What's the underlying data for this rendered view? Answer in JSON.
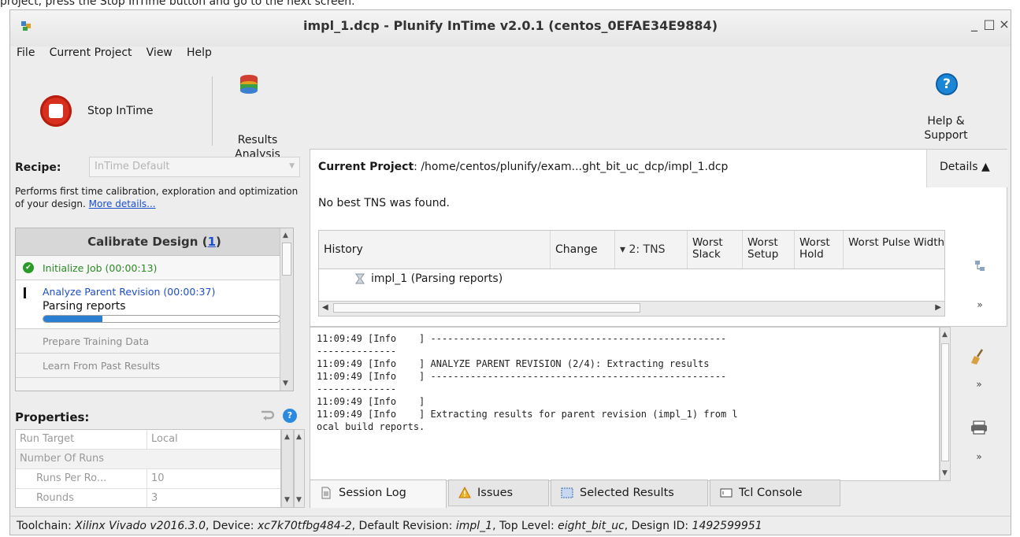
{
  "top_strip_text": "project, press the Stop InTime button and go to the next screen.",
  "window": {
    "title": "impl_1.dcp - Plunify InTime v2.0.1 (centos_0EFAE34E9884)",
    "controls": [
      "_",
      "□",
      "×"
    ]
  },
  "menu": [
    "File",
    "Current Project",
    "View",
    "Help"
  ],
  "toolbar": {
    "stop_label": "Stop InTime",
    "results_label": "Results Analysis",
    "help_label": "Help & Support",
    "help_glyph": "?"
  },
  "recipe": {
    "label": "Recipe:",
    "value": "InTime Default",
    "description": "Performs first time calibration, exploration and optimization of your design.",
    "more_link": "More details..."
  },
  "calibrate": {
    "header_prefix": "Calibrate Design (",
    "header_count": "1",
    "header_suffix": ")",
    "steps": [
      {
        "label": "Initialize Job (00:00:13)",
        "state": "done"
      },
      {
        "label": "Analyze Parent Revision (00:00:37)",
        "state": "active",
        "detail": "Parsing reports",
        "progress": 0.25
      },
      {
        "label": "Prepare Training Data",
        "state": "pending"
      },
      {
        "label": "Learn From Past Results",
        "state": "pending"
      }
    ]
  },
  "properties": {
    "label": "Properties:",
    "help_glyph": "?",
    "rows": [
      {
        "key": "Run Target",
        "value": "Local",
        "type": "row"
      },
      {
        "key": "Number Of Runs",
        "value": "",
        "type": "group"
      },
      {
        "key": "Runs Per Ro...",
        "value": "10",
        "type": "sub"
      },
      {
        "key": "Rounds",
        "value": "3",
        "type": "sub"
      }
    ]
  },
  "project": {
    "title_label": "Current Project",
    "path": ": /home/centos/plunify/exam...ght_bit_uc_dcp/impl_1.dcp",
    "details_label": "Details ▲",
    "message": "No best TNS was found."
  },
  "history": {
    "columns": [
      "History",
      "Change",
      "▾ 2: TNS",
      "Worst Slack",
      "Worst Setup",
      "Worst Hold",
      "Worst Pulse Width"
    ],
    "rows": [
      {
        "name": "impl_1 (Parsing reports)"
      }
    ]
  },
  "log": {
    "lines": [
      "11:09:49 [Info    ] ----------------------------------------------------",
      "--------------",
      "11:09:49 [Info    ] ANALYZE PARENT REVISION (2/4): Extracting results",
      "11:09:49 [Info    ] ----------------------------------------------------",
      "--------------",
      "11:09:49 [Info    ]",
      "11:09:49 [Info    ] Extracting results for parent revision (impl_1) from l",
      "ocal build reports."
    ]
  },
  "tabs": [
    {
      "label": "Session Log",
      "active": true
    },
    {
      "label": "Issues",
      "active": false
    },
    {
      "label": "Selected Results",
      "active": false
    },
    {
      "label": "Tcl Console",
      "active": false
    }
  ],
  "status": {
    "toolchain_label": "Toolchain: ",
    "toolchain": "Xilinx Vivado v2016.3.0",
    "device_label": ", Device: ",
    "device": "xc7k70tfbg484-2",
    "revision_label": ", Default Revision: ",
    "revision": "impl_1",
    "top_label": ", Top Level: ",
    "top": "eight_bit_uc",
    "design_label": ", Design ID: ",
    "design_id": "1492599951"
  },
  "colors": {
    "stop_red": "#d8301f",
    "done_green": "#2a8a25",
    "link_blue": "#1a4fd0",
    "progress_blue": "#2b7fd2",
    "help_blue": "#1c86d6"
  }
}
